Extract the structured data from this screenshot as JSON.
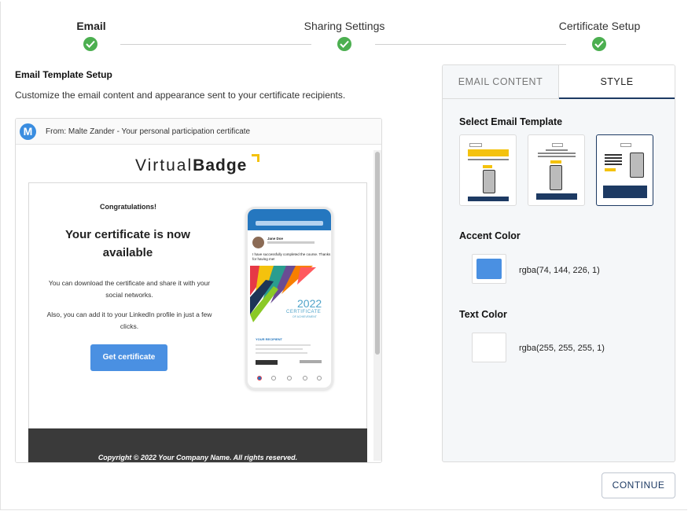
{
  "stepper": {
    "steps": [
      {
        "label": "Email",
        "state": "complete"
      },
      {
        "label": "Sharing Settings",
        "state": "complete"
      },
      {
        "label": "Certificate Setup",
        "state": "complete"
      }
    ],
    "complete_color": "#4caf50"
  },
  "section": {
    "title": "Email Template Setup",
    "description": "Customize the email content and appearance sent to your certificate recipients."
  },
  "preview": {
    "avatar_letter": "M",
    "from_line": "From: Malte Zander - Your personal participation certificate",
    "logo": {
      "light": "Virtual",
      "bold": "Badge"
    },
    "congrats": "Congratulations!",
    "headline": "Your certificate is now available",
    "paragraph1": "You can download the certificate and share it with your social networks.",
    "paragraph2": "Also, you can add it to your LinkedIn profile in just a few clicks.",
    "cta": "Get certificate",
    "copyright": "Copyright © 2022 Your Company Name. All rights reserved.",
    "phone": {
      "name": "Jane Doe",
      "post": "I have successfully completed the course. Thanks for having me!",
      "year": "2022",
      "cert_title": "CERTIFICATE",
      "cert_sub": "OF ACHIEVEMENT",
      "recipient": "YOUR RECIPIENT"
    }
  },
  "panel": {
    "tabs": [
      {
        "label": "EMAIL CONTENT",
        "active": false
      },
      {
        "label": "STYLE",
        "active": true
      }
    ],
    "template_heading": "Select Email Template",
    "selected_template": 3,
    "accent": {
      "heading": "Accent Color",
      "value": "rgba(74, 144, 226, 1)",
      "swatch": "#4a90e2"
    },
    "text": {
      "heading": "Text Color",
      "value": "rgba(255, 255, 255, 1)",
      "swatch": "#ffffff"
    }
  },
  "actions": {
    "continue_label": "CONTINUE"
  }
}
